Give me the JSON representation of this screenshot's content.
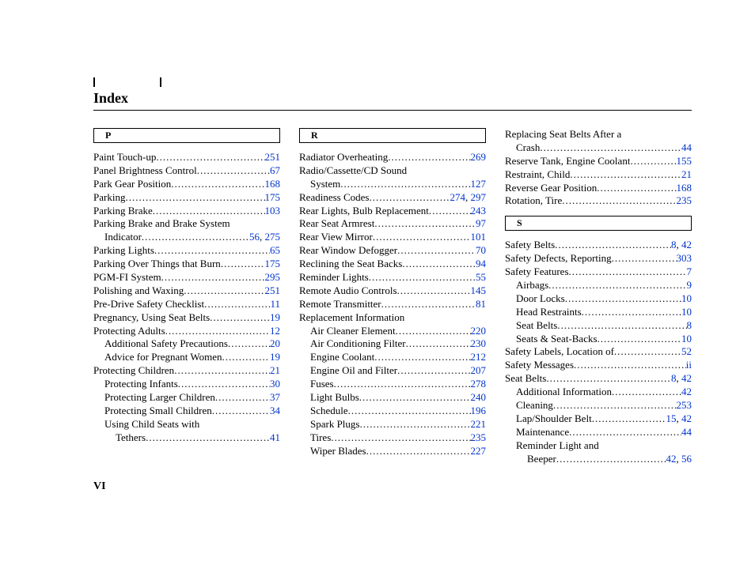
{
  "title": "Index",
  "page_number": "VI",
  "columns": [
    {
      "sections": [
        {
          "letter": "P",
          "entries": [
            {
              "label": "Paint Touch-up",
              "pages": [
                "251"
              ],
              "indent": 0
            },
            {
              "label": "Panel Brightness Control",
              "pages": [
                "67"
              ],
              "indent": 0
            },
            {
              "label": "Park Gear Position",
              "pages": [
                "168"
              ],
              "indent": 0
            },
            {
              "label": "Parking",
              "pages": [
                "175"
              ],
              "indent": 0
            },
            {
              "label": "Parking Brake",
              "pages": [
                "103"
              ],
              "indent": 0
            },
            {
              "label": "Parking Brake and Brake System",
              "pages": [],
              "indent": 0,
              "nowrap": true
            },
            {
              "label": "Indicator",
              "pages": [
                "56",
                "275"
              ],
              "indent": 0,
              "cont": true
            },
            {
              "label": "Parking Lights",
              "pages": [
                "65"
              ],
              "indent": 0
            },
            {
              "label": "Parking Over Things that Burn",
              "pages": [
                "175"
              ],
              "indent": 0
            },
            {
              "label": "PGM-FI System",
              "pages": [
                "295"
              ],
              "indent": 0
            },
            {
              "label": "Polishing and Waxing",
              "pages": [
                "251"
              ],
              "indent": 0
            },
            {
              "label": "Pre-Drive Safety Checklist",
              "pages": [
                "11"
              ],
              "indent": 0
            },
            {
              "label": "Pregnancy, Using Seat Belts",
              "pages": [
                "19"
              ],
              "indent": 0
            },
            {
              "label": "Protecting Adults",
              "pages": [
                "12"
              ],
              "indent": 0
            },
            {
              "label": "Additional Safety Precautions",
              "pages": [
                "20"
              ],
              "indent": 1
            },
            {
              "label": "Advice for Pregnant Women",
              "pages": [
                "19"
              ],
              "indent": 1
            },
            {
              "label": "Protecting Children",
              "pages": [
                "21"
              ],
              "indent": 0
            },
            {
              "label": "Protecting Infants",
              "pages": [
                "30"
              ],
              "indent": 1
            },
            {
              "label": "Protecting Larger Children",
              "pages": [
                "37"
              ],
              "indent": 1
            },
            {
              "label": "Protecting Small Children",
              "pages": [
                "34"
              ],
              "indent": 1
            },
            {
              "label": "Using Child Seats with",
              "pages": [],
              "indent": 1,
              "nowrap": true
            },
            {
              "label": "Tethers",
              "pages": [
                "41"
              ],
              "indent": 1,
              "cont": true
            }
          ]
        }
      ]
    },
    {
      "sections": [
        {
          "letter": "R",
          "entries": [
            {
              "label": "Radiator Overheating",
              "pages": [
                "269"
              ],
              "indent": 0
            },
            {
              "label": "Radio/Cassette/CD Sound",
              "pages": [],
              "indent": 0,
              "nowrap": true
            },
            {
              "label": "System",
              "pages": [
                "127"
              ],
              "indent": 0,
              "cont": true
            },
            {
              "label": "Readiness Codes",
              "pages": [
                "274",
                "297"
              ],
              "indent": 0
            },
            {
              "label": "Rear Lights, Bulb Replacement",
              "pages": [
                "243"
              ],
              "indent": 0
            },
            {
              "label": "Rear Seat Armrest",
              "pages": [
                "97"
              ],
              "indent": 0
            },
            {
              "label": "Rear View Mirror",
              "pages": [
                "101"
              ],
              "indent": 0
            },
            {
              "label": "Rear Window Defogger",
              "pages": [
                "70"
              ],
              "indent": 0
            },
            {
              "label": "Reclining the Seat Backs",
              "pages": [
                "94"
              ],
              "indent": 0
            },
            {
              "label": "Reminder Lights",
              "pages": [
                "55"
              ],
              "indent": 0
            },
            {
              "label": "Remote Audio Controls",
              "pages": [
                "145"
              ],
              "indent": 0
            },
            {
              "label": "Remote Transmitter",
              "pages": [
                "81"
              ],
              "indent": 0
            },
            {
              "label": "Replacement Information",
              "pages": [],
              "indent": 0,
              "nowrap": true
            },
            {
              "label": "Air Cleaner Element",
              "pages": [
                "220"
              ],
              "indent": 1
            },
            {
              "label": "Air Conditioning Filter",
              "pages": [
                "230"
              ],
              "indent": 1
            },
            {
              "label": "Engine Coolant",
              "pages": [
                "212"
              ],
              "indent": 1
            },
            {
              "label": "Engine Oil and Filter",
              "pages": [
                "207"
              ],
              "indent": 1
            },
            {
              "label": "Fuses",
              "pages": [
                "278"
              ],
              "indent": 1
            },
            {
              "label": "Light Bulbs",
              "pages": [
                "240"
              ],
              "indent": 1
            },
            {
              "label": "Schedule",
              "pages": [
                "196"
              ],
              "indent": 1
            },
            {
              "label": "Spark Plugs",
              "pages": [
                "221"
              ],
              "indent": 1
            },
            {
              "label": "Tires",
              "pages": [
                "235"
              ],
              "indent": 1
            },
            {
              "label": "Wiper Blades",
              "pages": [
                "227"
              ],
              "indent": 1
            }
          ]
        }
      ]
    },
    {
      "sections": [
        {
          "letter": null,
          "entries": [
            {
              "label": "Replacing Seat Belts After a",
              "pages": [],
              "indent": 0,
              "nowrap": true
            },
            {
              "label": "Crash",
              "pages": [
                "44"
              ],
              "indent": 0,
              "cont": true
            },
            {
              "label": "Reserve Tank, Engine Coolant",
              "pages": [
                "155"
              ],
              "indent": 0
            },
            {
              "label": "Restraint, Child",
              "pages": [
                "21"
              ],
              "indent": 0
            },
            {
              "label": "Reverse Gear Position",
              "pages": [
                "168"
              ],
              "indent": 0
            },
            {
              "label": "Rotation, Tire",
              "pages": [
                "235"
              ],
              "indent": 0
            }
          ]
        },
        {
          "letter": "S",
          "entries": [
            {
              "label": "Safety Belts",
              "pages": [
                "8",
                "42"
              ],
              "indent": 0
            },
            {
              "label": "Safety Defects, Reporting ",
              "pages": [
                "303"
              ],
              "indent": 0
            },
            {
              "label": "Safety Features",
              "pages": [
                "7"
              ],
              "indent": 0
            },
            {
              "label": "Airbags",
              "pages": [
                "9"
              ],
              "indent": 1
            },
            {
              "label": "Door Locks",
              "pages": [
                "10"
              ],
              "indent": 1
            },
            {
              "label": "Head Restraints",
              "pages": [
                "10"
              ],
              "indent": 1
            },
            {
              "label": "Seat Belts",
              "pages": [
                "8"
              ],
              "indent": 1
            },
            {
              "label": "Seats & Seat-Backs",
              "pages": [
                "10"
              ],
              "indent": 1
            },
            {
              "label": "Safety Labels, Location of",
              "pages": [
                "52"
              ],
              "indent": 0
            },
            {
              "label": "Safety Messages",
              "pages": [
                "ii"
              ],
              "indent": 0
            },
            {
              "label": "Seat Belts",
              "pages": [
                "8",
                "42"
              ],
              "indent": 0
            },
            {
              "label": "Additional Information",
              "pages": [
                "42"
              ],
              "indent": 1
            },
            {
              "label": "Cleaning",
              "pages": [
                "253"
              ],
              "indent": 1
            },
            {
              "label": "Lap/Shoulder Belt",
              "pages": [
                "15",
                "42"
              ],
              "indent": 1
            },
            {
              "label": "Maintenance",
              "pages": [
                "44"
              ],
              "indent": 1
            },
            {
              "label": "Reminder Light and",
              "pages": [],
              "indent": 1,
              "nowrap": true
            },
            {
              "label": "Beeper",
              "pages": [
                "42",
                "56"
              ],
              "indent": 1,
              "cont": true
            }
          ]
        }
      ]
    }
  ]
}
